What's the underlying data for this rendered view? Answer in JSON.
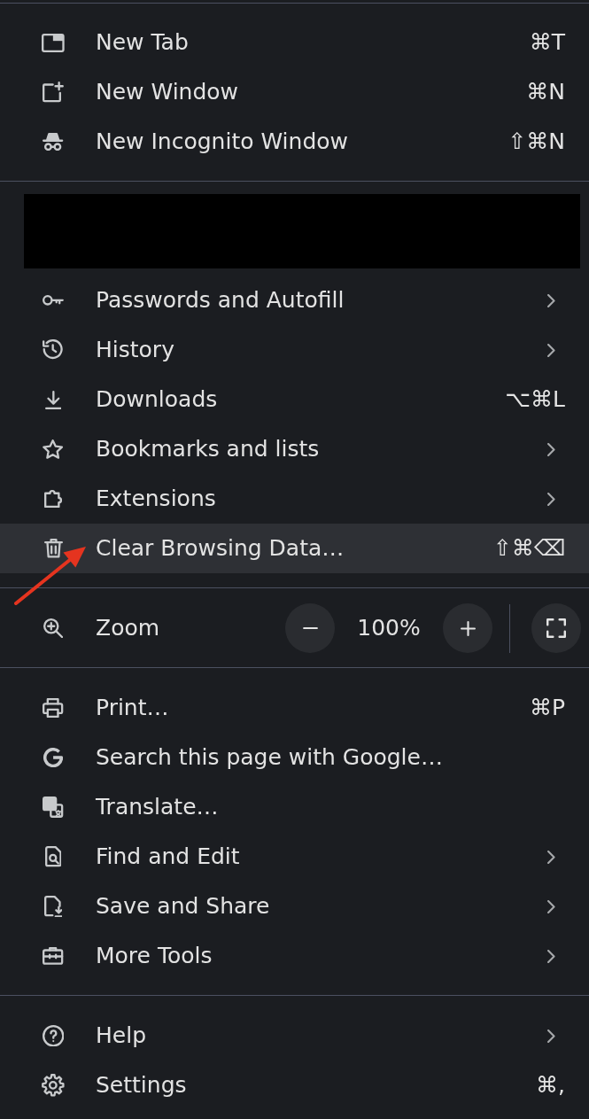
{
  "menu": [
    {
      "kind": "item",
      "label": "New Tab",
      "shortcut": "⌘T",
      "submenu": false,
      "highlighted": false
    },
    {
      "kind": "item",
      "label": "New Window",
      "shortcut": "⌘N",
      "submenu": false,
      "highlighted": false
    },
    {
      "kind": "item",
      "label": "New Incognito Window",
      "shortcut": "⇧⌘N",
      "submenu": false,
      "highlighted": false
    },
    {
      "kind": "separator"
    },
    {
      "kind": "redacted"
    },
    {
      "kind": "item",
      "label": "Passwords and Autofill",
      "submenu": true,
      "highlighted": false
    },
    {
      "kind": "item",
      "label": "History",
      "submenu": true,
      "highlighted": false
    },
    {
      "kind": "item",
      "label": "Downloads",
      "shortcut": "⌥⌘L",
      "submenu": false,
      "highlighted": false
    },
    {
      "kind": "item",
      "label": "Bookmarks and lists",
      "submenu": true,
      "highlighted": false
    },
    {
      "kind": "item",
      "label": "Extensions",
      "submenu": true,
      "highlighted": false
    },
    {
      "kind": "item",
      "label": "Clear Browsing Data…",
      "shortcut": "⇧⌘⌫",
      "submenu": false,
      "highlighted": true
    },
    {
      "kind": "separator"
    },
    {
      "kind": "zoom",
      "label": "Zoom",
      "value": "100%"
    },
    {
      "kind": "separator"
    },
    {
      "kind": "item",
      "label": "Print…",
      "shortcut": "⌘P",
      "submenu": false,
      "highlighted": false
    },
    {
      "kind": "item",
      "label": "Search this page with Google…",
      "submenu": false,
      "highlighted": false
    },
    {
      "kind": "item",
      "label": "Translate…",
      "submenu": false,
      "highlighted": false
    },
    {
      "kind": "item",
      "label": "Find and Edit",
      "submenu": true,
      "highlighted": false
    },
    {
      "kind": "item",
      "label": "Save and Share",
      "submenu": true,
      "highlighted": false
    },
    {
      "kind": "item",
      "label": "More Tools",
      "submenu": true,
      "highlighted": false
    },
    {
      "kind": "separator"
    },
    {
      "kind": "item",
      "label": "Help",
      "submenu": true,
      "highlighted": false
    },
    {
      "kind": "item",
      "label": "Settings",
      "shortcut": "⌘,",
      "submenu": false,
      "highlighted": false
    }
  ]
}
